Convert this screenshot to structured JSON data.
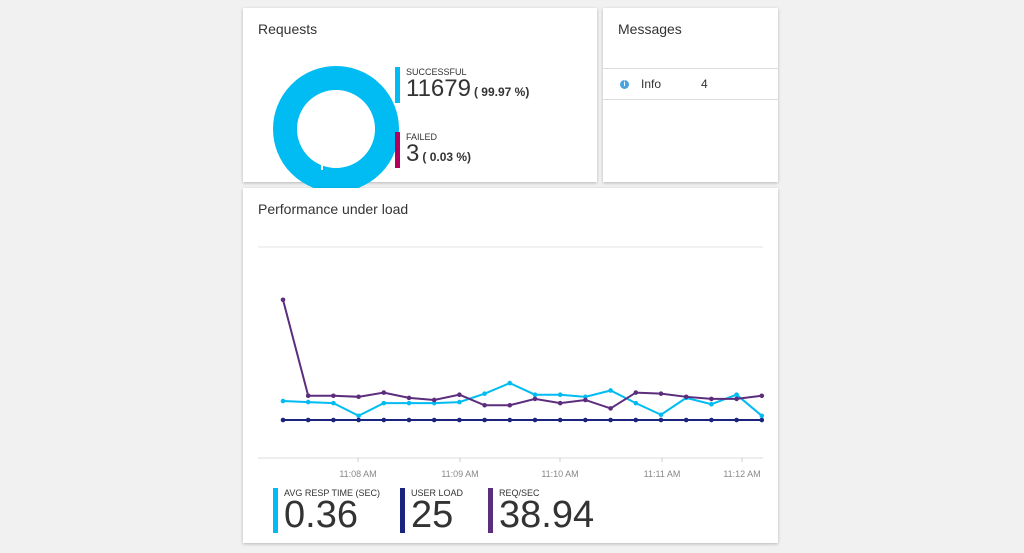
{
  "requests": {
    "title": "Requests",
    "successful": {
      "label": "SUCCESSFUL",
      "value": "11679",
      "percent": "( 99.97 %)",
      "color": "#00bcf2"
    },
    "failed": {
      "label": "FAILED",
      "value": "3",
      "percent": "( 0.03 %)",
      "color": "#b4005c"
    }
  },
  "messages": {
    "title": "Messages",
    "items": [
      {
        "icon": "info-icon",
        "label": "Info",
        "count": "4"
      }
    ]
  },
  "performance": {
    "title": "Performance under load",
    "metrics": [
      {
        "label": "AVG RESP TIME (SEC)",
        "value": "0.36",
        "color": "#00bcf2"
      },
      {
        "label": "USER LOAD",
        "value": "25",
        "color": "#1a237e"
      },
      {
        "label": "REQ/SEC",
        "value": "38.94",
        "color": "#5c2d7d"
      }
    ]
  },
  "chart_data": {
    "type": "line",
    "title": "Performance under load",
    "x_tick_labels": [
      "11:08 AM",
      "11:09 AM",
      "11:10 AM",
      "11:11 AM",
      "11:12 AM"
    ],
    "grid": false,
    "series": [
      {
        "name": "AVG RESP TIME (SEC)",
        "color": "#00bcf2",
        "values": [
          0.54,
          0.53,
          0.52,
          0.4,
          0.52,
          0.52,
          0.52,
          0.53,
          0.61,
          0.71,
          0.6,
          0.6,
          0.58,
          0.64,
          0.52,
          0.41,
          0.57,
          0.51,
          0.6,
          0.4
        ]
      },
      {
        "name": "USER LOAD",
        "color": "#1a237e",
        "values": [
          0.36,
          0.36,
          0.36,
          0.36,
          0.36,
          0.36,
          0.36,
          0.36,
          0.36,
          0.36,
          0.36,
          0.36,
          0.36,
          0.36,
          0.36,
          0.36,
          0.36,
          0.36,
          0.36,
          0.36
        ]
      },
      {
        "name": "REQ/SEC",
        "color": "#5c2d7d",
        "values": [
          1.5,
          0.59,
          0.59,
          0.58,
          0.62,
          0.57,
          0.55,
          0.6,
          0.5,
          0.5,
          0.56,
          0.52,
          0.55,
          0.47,
          0.62,
          0.61,
          0.58,
          0.56,
          0.56,
          0.59
        ]
      }
    ]
  }
}
